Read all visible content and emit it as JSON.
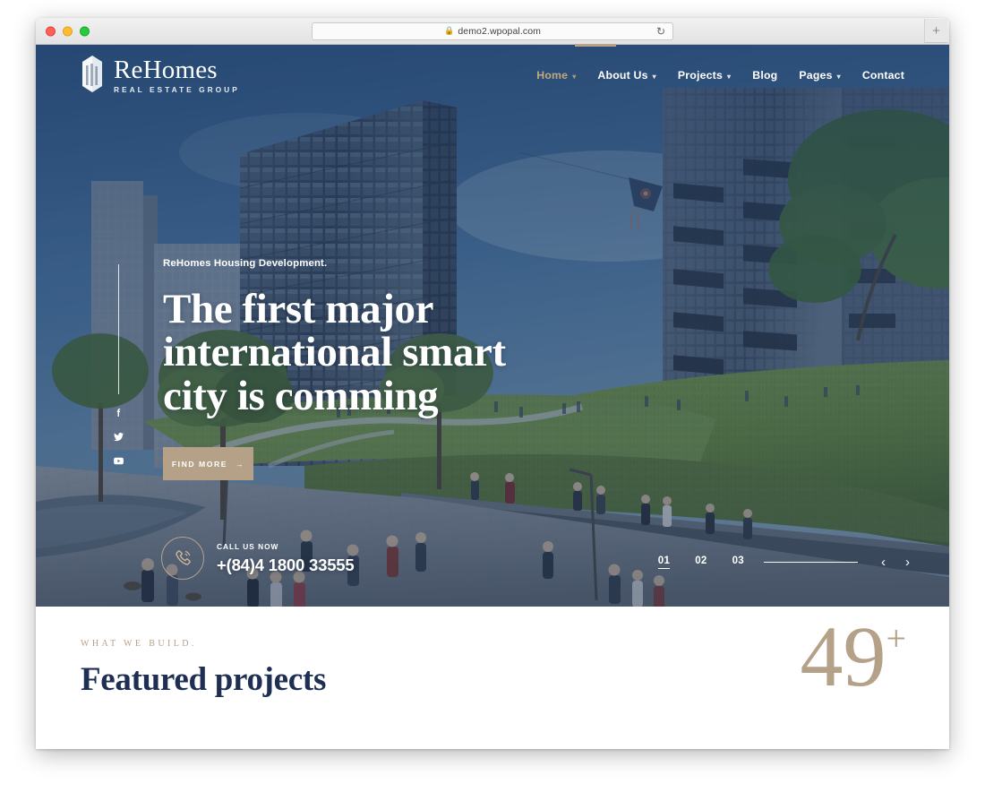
{
  "browser": {
    "url": "demo2.wpopal.com",
    "lock_icon": "lock-icon",
    "reload_icon": "reload-icon",
    "new_tab_label": "+",
    "traffic_lights": [
      "close",
      "minimize",
      "maximize"
    ]
  },
  "site": {
    "brand": {
      "name": "ReHomes",
      "tagline": "REAL ESTATE GROUP",
      "mark_icon": "building-logo-icon"
    },
    "nav": [
      {
        "label": "Home",
        "has_chevron": true,
        "active": true
      },
      {
        "label": "About Us",
        "has_chevron": true,
        "active": false
      },
      {
        "label": "Projects",
        "has_chevron": true,
        "active": false
      },
      {
        "label": "Blog",
        "has_chevron": false,
        "active": false
      },
      {
        "label": "Pages",
        "has_chevron": true,
        "active": false
      },
      {
        "label": "Contact",
        "has_chevron": false,
        "active": false
      }
    ],
    "social": [
      {
        "name": "facebook-icon"
      },
      {
        "name": "twitter-icon"
      },
      {
        "name": "youtube-icon"
      }
    ]
  },
  "hero": {
    "eyebrow": "ReHomes Housing Development.",
    "title_line1": "The first major",
    "title_line2": "international smart",
    "title_line3": "city is comming",
    "cta_label": "FIND MORE",
    "cta_arrow": "→",
    "call_label": "CALL US NOW",
    "call_number": "+(84)4 1800 33555",
    "phone_icon": "phone-icon",
    "slides": [
      {
        "label": "01",
        "active": true
      },
      {
        "label": "02",
        "active": false
      },
      {
        "label": "03",
        "active": false
      }
    ],
    "prev_arrow": "‹",
    "next_arrow": "›"
  },
  "featured": {
    "eyebrow": "WHAT WE BUILD.",
    "title": "Featured projects",
    "count": "49",
    "count_suffix": "+"
  },
  "colors": {
    "accent_gold": "#b5a088",
    "accent_nav_active": "#c2a87e",
    "navy": "#1f2f54",
    "hero_tint": "#1f3a5f",
    "white": "#ffffff"
  }
}
